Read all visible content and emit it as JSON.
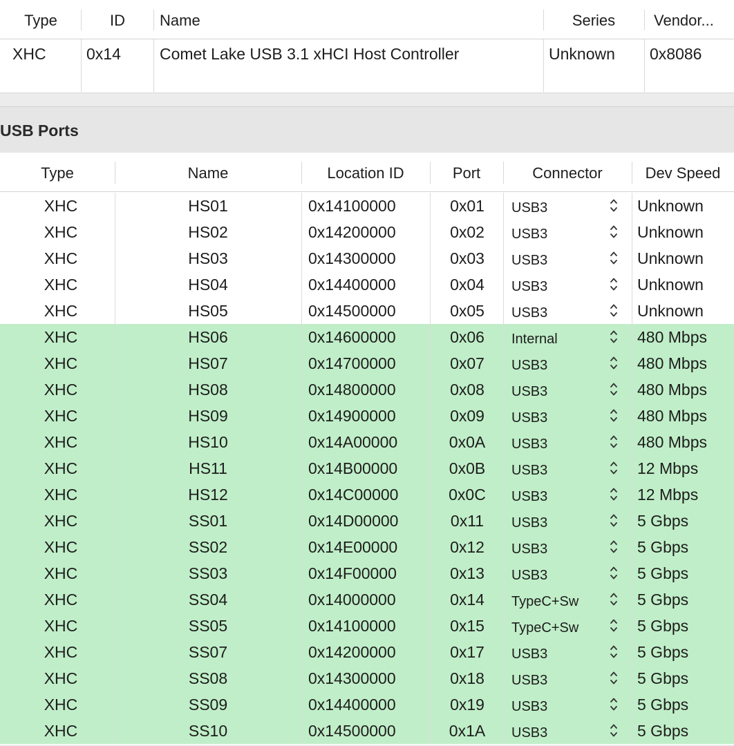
{
  "controller_table": {
    "headers": {
      "type": "Type",
      "id": "ID",
      "name": "Name",
      "series": "Series",
      "vendor": "Vendor..."
    },
    "row": {
      "type": "XHC",
      "id": "0x14",
      "name": "Comet Lake USB 3.1 xHCI Host Controller",
      "series": "Unknown",
      "vendor": "0x8086"
    }
  },
  "section": {
    "title": "USB Ports"
  },
  "ports_table": {
    "headers": {
      "type": "Type",
      "name": "Name",
      "location": "Location ID",
      "port": "Port",
      "connector": "Connector",
      "speed": "Dev Speed"
    },
    "rows": [
      {
        "type": "XHC",
        "name": "HS01",
        "location": "0x14100000",
        "port": "0x01",
        "connector": "USB3",
        "speed": "Unknown",
        "selected": false
      },
      {
        "type": "XHC",
        "name": "HS02",
        "location": "0x14200000",
        "port": "0x02",
        "connector": "USB3",
        "speed": "Unknown",
        "selected": false
      },
      {
        "type": "XHC",
        "name": "HS03",
        "location": "0x14300000",
        "port": "0x03",
        "connector": "USB3",
        "speed": "Unknown",
        "selected": false
      },
      {
        "type": "XHC",
        "name": "HS04",
        "location": "0x14400000",
        "port": "0x04",
        "connector": "USB3",
        "speed": "Unknown",
        "selected": false
      },
      {
        "type": "XHC",
        "name": "HS05",
        "location": "0x14500000",
        "port": "0x05",
        "connector": "USB3",
        "speed": "Unknown",
        "selected": false
      },
      {
        "type": "XHC",
        "name": "HS06",
        "location": "0x14600000",
        "port": "0x06",
        "connector": "Internal",
        "speed": "480 Mbps",
        "selected": true
      },
      {
        "type": "XHC",
        "name": "HS07",
        "location": "0x14700000",
        "port": "0x07",
        "connector": "USB3",
        "speed": "480 Mbps",
        "selected": true
      },
      {
        "type": "XHC",
        "name": "HS08",
        "location": "0x14800000",
        "port": "0x08",
        "connector": "USB3",
        "speed": "480 Mbps",
        "selected": true
      },
      {
        "type": "XHC",
        "name": "HS09",
        "location": "0x14900000",
        "port": "0x09",
        "connector": "USB3",
        "speed": "480 Mbps",
        "selected": true
      },
      {
        "type": "XHC",
        "name": "HS10",
        "location": "0x14A00000",
        "port": "0x0A",
        "connector": "USB3",
        "speed": "480 Mbps",
        "selected": true
      },
      {
        "type": "XHC",
        "name": "HS11",
        "location": "0x14B00000",
        "port": "0x0B",
        "connector": "USB3",
        "speed": "12 Mbps",
        "selected": true
      },
      {
        "type": "XHC",
        "name": "HS12",
        "location": "0x14C00000",
        "port": "0x0C",
        "connector": "USB3",
        "speed": "12 Mbps",
        "selected": true
      },
      {
        "type": "XHC",
        "name": "SS01",
        "location": "0x14D00000",
        "port": "0x11",
        "connector": "USB3",
        "speed": "5 Gbps",
        "selected": true
      },
      {
        "type": "XHC",
        "name": "SS02",
        "location": "0x14E00000",
        "port": "0x12",
        "connector": "USB3",
        "speed": "5 Gbps",
        "selected": true
      },
      {
        "type": "XHC",
        "name": "SS03",
        "location": "0x14F00000",
        "port": "0x13",
        "connector": "USB3",
        "speed": "5 Gbps",
        "selected": true
      },
      {
        "type": "XHC",
        "name": "SS04",
        "location": "0x14000000",
        "port": "0x14",
        "connector": "TypeC+Sw",
        "speed": "5 Gbps",
        "selected": true
      },
      {
        "type": "XHC",
        "name": "SS05",
        "location": "0x14100000",
        "port": "0x15",
        "connector": "TypeC+Sw",
        "speed": "5 Gbps",
        "selected": true
      },
      {
        "type": "XHC",
        "name": "SS07",
        "location": "0x14200000",
        "port": "0x17",
        "connector": "USB3",
        "speed": "5 Gbps",
        "selected": true
      },
      {
        "type": "XHC",
        "name": "SS08",
        "location": "0x14300000",
        "port": "0x18",
        "connector": "USB3",
        "speed": "5 Gbps",
        "selected": true
      },
      {
        "type": "XHC",
        "name": "SS09",
        "location": "0x14400000",
        "port": "0x19",
        "connector": "USB3",
        "speed": "5 Gbps",
        "selected": true
      },
      {
        "type": "XHC",
        "name": "SS10",
        "location": "0x14500000",
        "port": "0x1A",
        "connector": "USB3",
        "speed": "5 Gbps",
        "selected": true
      }
    ]
  }
}
